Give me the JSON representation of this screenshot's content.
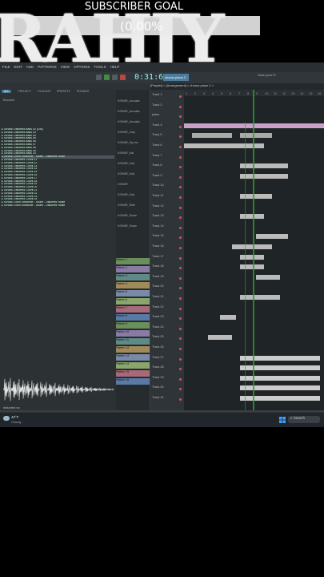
{
  "overlay": {
    "goal_title": "SUBSCRIBER GOAL",
    "goal_percent": "(0.00%",
    "goal_progress": 0.0,
    "big_text": "RAHJY",
    "bar_color": "#2ecc71"
  },
  "menubar": {
    "items": [
      "FILE",
      "EDIT",
      "ADD",
      "PATTERNS",
      "VIEW",
      "OPTIONS",
      "TOOLS",
      "HELP"
    ],
    "time": "0:31:62",
    "project_label": "chorus piano 2",
    "hint": "[Playlist] > [Arrangement] > chorus piano 2 >",
    "cpu_text": "Save your Fl"
  },
  "browser": {
    "tabs": [
      "ALL",
      "PROJECT",
      "PLUGINS",
      "PRESETS",
      "SOUNDS"
    ],
    "active_tab": "ALL",
    "header": "Browser",
    "items": [
      "IGNME Distorted Bass 02 [145]",
      "IGNME Distorted Bass 03",
      "IGNME Distorted Bass 04",
      "IGNME Distorted Bass 05",
      "IGNME Distorted Bass 06",
      "IGNME Distorted Bass 07",
      "IGNME Distorted Bass 08",
      "IGNME Distorted Bass 09",
      "IGNME Distorted Bass 10",
      "IGNME Drum Enhancer - Snare - Distorted Noise",
      "IGNME Distorted Count 11",
      "IGNME Distorted Count 12",
      "IGNME Distorted Count 13",
      "IGNME Distorted Count 14",
      "IGNME Distorted Count 15",
      "IGNME Distorted Count 16",
      "IGNME Distorted Count 17",
      "IGNME Distorted Count 18",
      "IGNME Distorted Count 19",
      "IGNME Distorted Count 20",
      "IGNME Distorted Count 21",
      "IGNME Distorted Count 22",
      "IGNME Distorted Count 23",
      "IGNME Distorted Count 24",
      "IGNME Drum Enhancer - Snare - Distorted Noise",
      "IGNME Drum Enhancer - Snare - Distorted Noise"
    ],
    "selected_index": 9,
    "footer": "distorted sn"
  },
  "tracks": [
    "Track 1",
    "Track 2",
    "piano",
    "Track 4",
    "Track 5",
    "Track 6",
    "Track 7",
    "Track 8",
    "Track 9",
    "Track 10",
    "Track 11",
    "Track 12",
    "Track 13",
    "Track 14",
    "Track 15",
    "Track 16",
    "Track 17",
    "Track 18",
    "Track 19",
    "Track 20",
    "Track 21",
    "Track 22",
    "Track 23",
    "Track 24",
    "Track 25",
    "Track 26",
    "Track 27",
    "Track 28",
    "Track 29",
    "Track 30",
    "Track 31"
  ],
  "channels": [
    "KSHMR_Acoustic",
    "KSHMR_Acoustic",
    "KSHMR_Acoustic",
    "KSHMR_Clap",
    "KSHMR_Hip Ins",
    "KSHMR_Hat",
    "KSHMR_Kick",
    "KSHMR_Kick",
    "KSHMR",
    "KSHMR_Kick",
    "KSHMR_Ride",
    "KSHMR_Snare",
    "KSHMR_Snare"
  ],
  "patterns": [
    "Pattern 1",
    "Pattern 2",
    "Pattern 3",
    "Pattern 4",
    "Pattern 5",
    "Pattern 6",
    "Pattern 7",
    "Pattern 8",
    "Pattern 9",
    "Pattern 10",
    "Pattern 11",
    "Pattern 12",
    "Pattern 13",
    "Pattern 14",
    "Pattern 15",
    "Pattern 16"
  ],
  "taskbar": {
    "temp": "40°F",
    "weather": "Cloudy",
    "search": "Search"
  },
  "colors": {
    "accent": "#4c7d9e",
    "playhead": "#2f9e2f"
  }
}
